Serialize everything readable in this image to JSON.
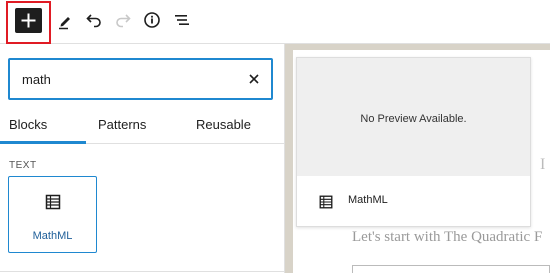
{
  "toolbar": {
    "add_icon": "plus-icon",
    "tools_icon": "pencil-icon",
    "undo_icon": "undo-icon",
    "redo_icon": "redo-icon",
    "details_icon": "info-icon",
    "list_view_icon": "list-view-icon"
  },
  "inserter": {
    "search": {
      "value": "math",
      "placeholder": ""
    },
    "tabs": [
      "Blocks",
      "Patterns",
      "Reusable"
    ],
    "category": "TEXT",
    "result": {
      "label": "MathML",
      "icon": "table-grid-icon"
    }
  },
  "preview": {
    "message": "No Preview Available.",
    "block_title": "MathML"
  },
  "editor": {
    "paragraph": "Let's start with The Quadratic F",
    "peek": "I"
  },
  "colors": {
    "accent": "#1f88d0",
    "highlight": "#e01b24",
    "editor_bg": "#d8d3c8"
  }
}
